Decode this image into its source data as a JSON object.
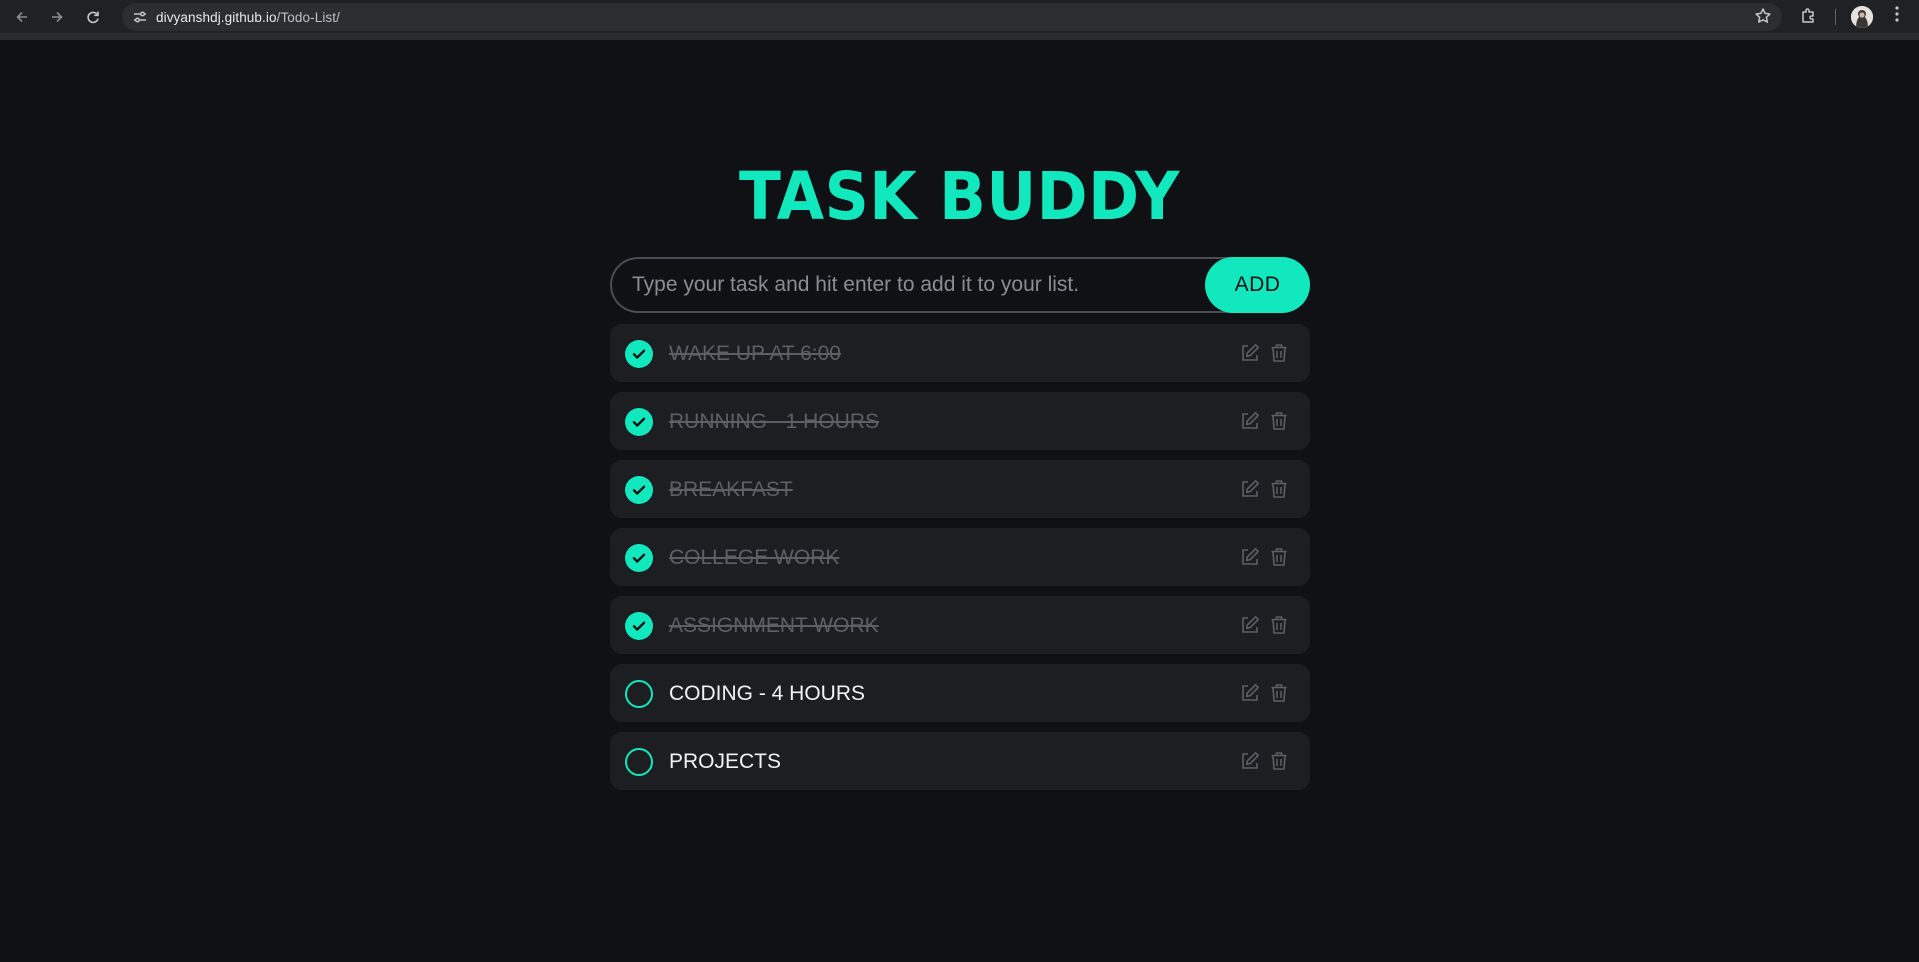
{
  "browser": {
    "url_host": "divyanshdj.github.io",
    "url_path": "/Todo-List/",
    "icons": {
      "back": "back-arrow-icon",
      "forward": "forward-arrow-icon",
      "reload": "reload-icon",
      "site_info": "site-settings-icon",
      "bookmark": "star-icon",
      "extensions": "puzzle-icon",
      "profile": "avatar",
      "menu": "kebab-menu-icon"
    }
  },
  "app": {
    "title": "TASK BUDDY",
    "input_placeholder": "Type your task and hit enter to add it to your list.",
    "add_label": "ADD",
    "accent_color": "#12e8be",
    "tasks": [
      {
        "label": "WAKE UP AT 6:00",
        "done": true
      },
      {
        "label": "RUNNING - 1 HOURS",
        "done": true
      },
      {
        "label": "BREAKFAST",
        "done": true
      },
      {
        "label": "COLLEGE WORK",
        "done": true
      },
      {
        "label": "ASSIGNMENT WORK",
        "done": true
      },
      {
        "label": "CODING - 4 HOURS",
        "done": false
      },
      {
        "label": "PROJECTS",
        "done": false
      }
    ]
  }
}
